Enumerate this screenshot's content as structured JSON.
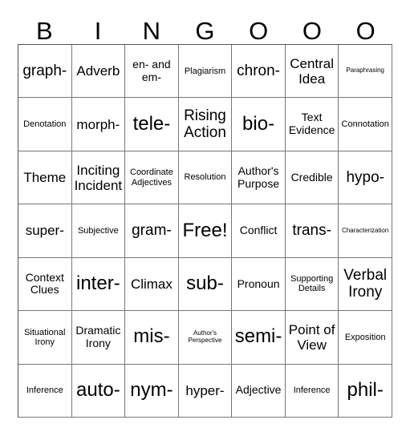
{
  "header": [
    "B",
    "I",
    "N",
    "G",
    "O",
    "O",
    "O"
  ],
  "cells": [
    {
      "text": "graph-",
      "size": "s-xl"
    },
    {
      "text": "Adverb",
      "size": "s-lg"
    },
    {
      "text": "en- and em-",
      "size": "s-md"
    },
    {
      "text": "Plagiarism",
      "size": "s-sm"
    },
    {
      "text": "chron-",
      "size": "s-xl"
    },
    {
      "text": "Central Idea",
      "size": "s-lg"
    },
    {
      "text": "Paraphrasing",
      "size": "s-xs"
    },
    {
      "text": "Denotation",
      "size": "s-sm"
    },
    {
      "text": "morph-",
      "size": "s-lg"
    },
    {
      "text": "tele-",
      "size": "s-xxl"
    },
    {
      "text": "Rising Action",
      "size": "s-xl"
    },
    {
      "text": "bio-",
      "size": "s-xxl"
    },
    {
      "text": "Text Evidence",
      "size": "s-md"
    },
    {
      "text": "Connotation",
      "size": "s-sm"
    },
    {
      "text": "Theme",
      "size": "s-lg"
    },
    {
      "text": "Inciting Incident",
      "size": "s-lg"
    },
    {
      "text": "Coordinate Adjectives",
      "size": "s-sm"
    },
    {
      "text": "Resolution",
      "size": "s-sm"
    },
    {
      "text": "Author's Purpose",
      "size": "s-md"
    },
    {
      "text": "Credible",
      "size": "s-md"
    },
    {
      "text": "hypo-",
      "size": "s-xl"
    },
    {
      "text": "super-",
      "size": "s-lg"
    },
    {
      "text": "Subjective",
      "size": "s-sm"
    },
    {
      "text": "gram-",
      "size": "s-xl"
    },
    {
      "text": "Free!",
      "size": "s-xxl"
    },
    {
      "text": "Conflict",
      "size": "s-md"
    },
    {
      "text": "trans-",
      "size": "s-xl"
    },
    {
      "text": "Characterization",
      "size": "s-xs"
    },
    {
      "text": "Context Clues",
      "size": "s-md"
    },
    {
      "text": "inter-",
      "size": "s-xxl"
    },
    {
      "text": "Climax",
      "size": "s-lg"
    },
    {
      "text": "sub-",
      "size": "s-xxl"
    },
    {
      "text": "Pronoun",
      "size": "s-md"
    },
    {
      "text": "Supporting Details",
      "size": "s-sm"
    },
    {
      "text": "Verbal Irony",
      "size": "s-xl"
    },
    {
      "text": "Situational Irony",
      "size": "s-sm"
    },
    {
      "text": "Dramatic Irony",
      "size": "s-md"
    },
    {
      "text": "mis-",
      "size": "s-xxl"
    },
    {
      "text": "Author's Perspective",
      "size": "s-xs"
    },
    {
      "text": "semi-",
      "size": "s-xxl"
    },
    {
      "text": "Point of View",
      "size": "s-lg"
    },
    {
      "text": "Exposition",
      "size": "s-sm"
    },
    {
      "text": "Inference",
      "size": "s-sm"
    },
    {
      "text": "auto-",
      "size": "s-xxl"
    },
    {
      "text": "nym-",
      "size": "s-xxl"
    },
    {
      "text": "hyper-",
      "size": "s-lg"
    },
    {
      "text": "Adjective",
      "size": "s-md"
    },
    {
      "text": "Inference",
      "size": "s-sm"
    },
    {
      "text": "phil-",
      "size": "s-xxl"
    }
  ]
}
